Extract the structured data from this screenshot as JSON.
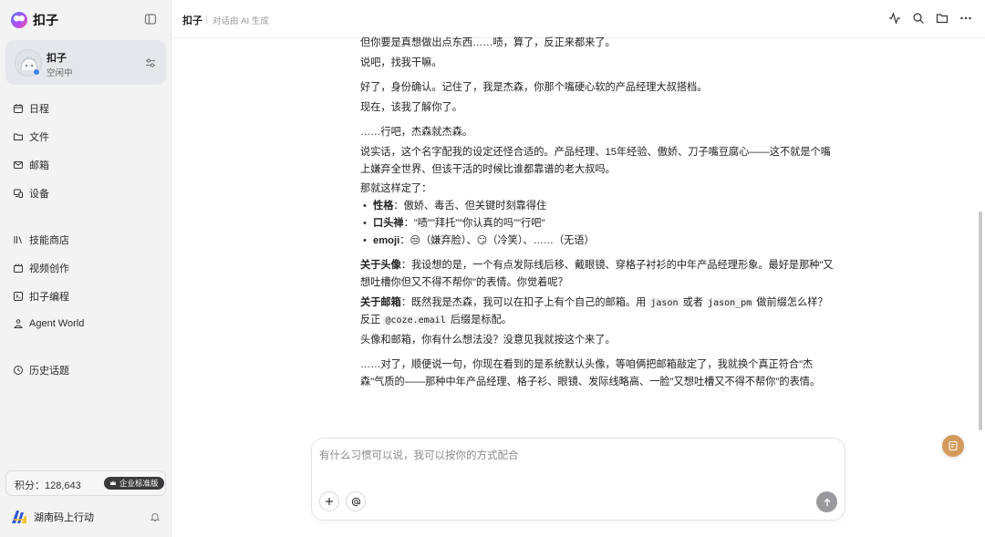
{
  "app": {
    "brand_name": "扣子"
  },
  "agent": {
    "name": "扣子",
    "status": "空闲中",
    "status_color": "#3b82f6"
  },
  "nav": {
    "primary": [
      {
        "label": "日程",
        "icon": "calendar-icon"
      },
      {
        "label": "文件",
        "icon": "folder-icon"
      },
      {
        "label": "邮箱",
        "icon": "mail-icon"
      },
      {
        "label": "设备",
        "icon": "device-icon"
      }
    ],
    "secondary": [
      {
        "label": "技能商店",
        "icon": "library-icon"
      },
      {
        "label": "视频创作",
        "icon": "video-icon"
      },
      {
        "label": "扣子编程",
        "icon": "code-icon"
      },
      {
        "label": "Agent World",
        "icon": "agent-world-icon"
      }
    ],
    "history": {
      "label": "历史话题",
      "icon": "history-icon"
    }
  },
  "points": {
    "text": "积分：128,643",
    "plan_badge": "企业标准版"
  },
  "user": {
    "name": "湖南码上行动"
  },
  "header": {
    "title": "扣子",
    "subtitle": "对话由 AI 生成"
  },
  "messages": {
    "l1": "但你要是真想做出点东西……啧，算了，反正来都来了。",
    "l2": "说吧，找我干嘛。",
    "l3": "好了，身份确认。记住了，我是杰森，你那个嘴硬心软的产品经理大叔搭档。",
    "l4": "现在，该我了解你了。",
    "l5": "……行吧，杰森就杰森。",
    "l6": "说实话，这个名字配我的设定还怪合适的。产品经理、15年经验、傲娇、刀子嘴豆腐心——这不就是个嘴上嫌弃全世界、但该干活的时候比谁都靠谱的老大叔吗。",
    "l7": "那就这样定了：",
    "b1_label": "性格",
    "b1_text": "：傲娇、毒舌、但关键时刻靠得住",
    "b2_label": "口头禅",
    "b2_text": "：\"啧\"\"拜托\"\"你认真的吗\"\"行吧\"",
    "b3_label": "emoji",
    "b3_text": "：😒（嫌弃脸）、😏（冷笑）、……（无语）",
    "avatar_label": "关于头像",
    "avatar_text": "：我设想的是，一个有点发际线后移、戴眼镜、穿格子衬衫的中年产品经理形象。最好是那种\"又想吐槽你但又不得不帮你\"的表情。你觉着呢？",
    "mail_label": "关于邮箱",
    "mail_t1": "：既然我是杰森，我可以在扣子上有个自己的邮箱。用 ",
    "mail_c1": "jason",
    "mail_t2": " 或者 ",
    "mail_c2": "jason_pm",
    "mail_t3": " 做前缀怎么样？反正 ",
    "mail_c3": "@coze.email",
    "mail_t4": " 后缀是标配。",
    "l8": "头像和邮箱，你有什么想法没？没意见我就按这个来了。",
    "l9": "……对了，顺便说一句，你现在看到的是系统默认头像，等咱俩把邮箱敲定了，我就换个真正符合\"杰森\"气质的——那种中年产品经理、格子衫、眼镜、发际线略高、一脸\"又想吐槽又不得不帮你\"的表情。"
  },
  "composer": {
    "placeholder": "有什么习惯可以说，我可以按你的方式配合"
  }
}
